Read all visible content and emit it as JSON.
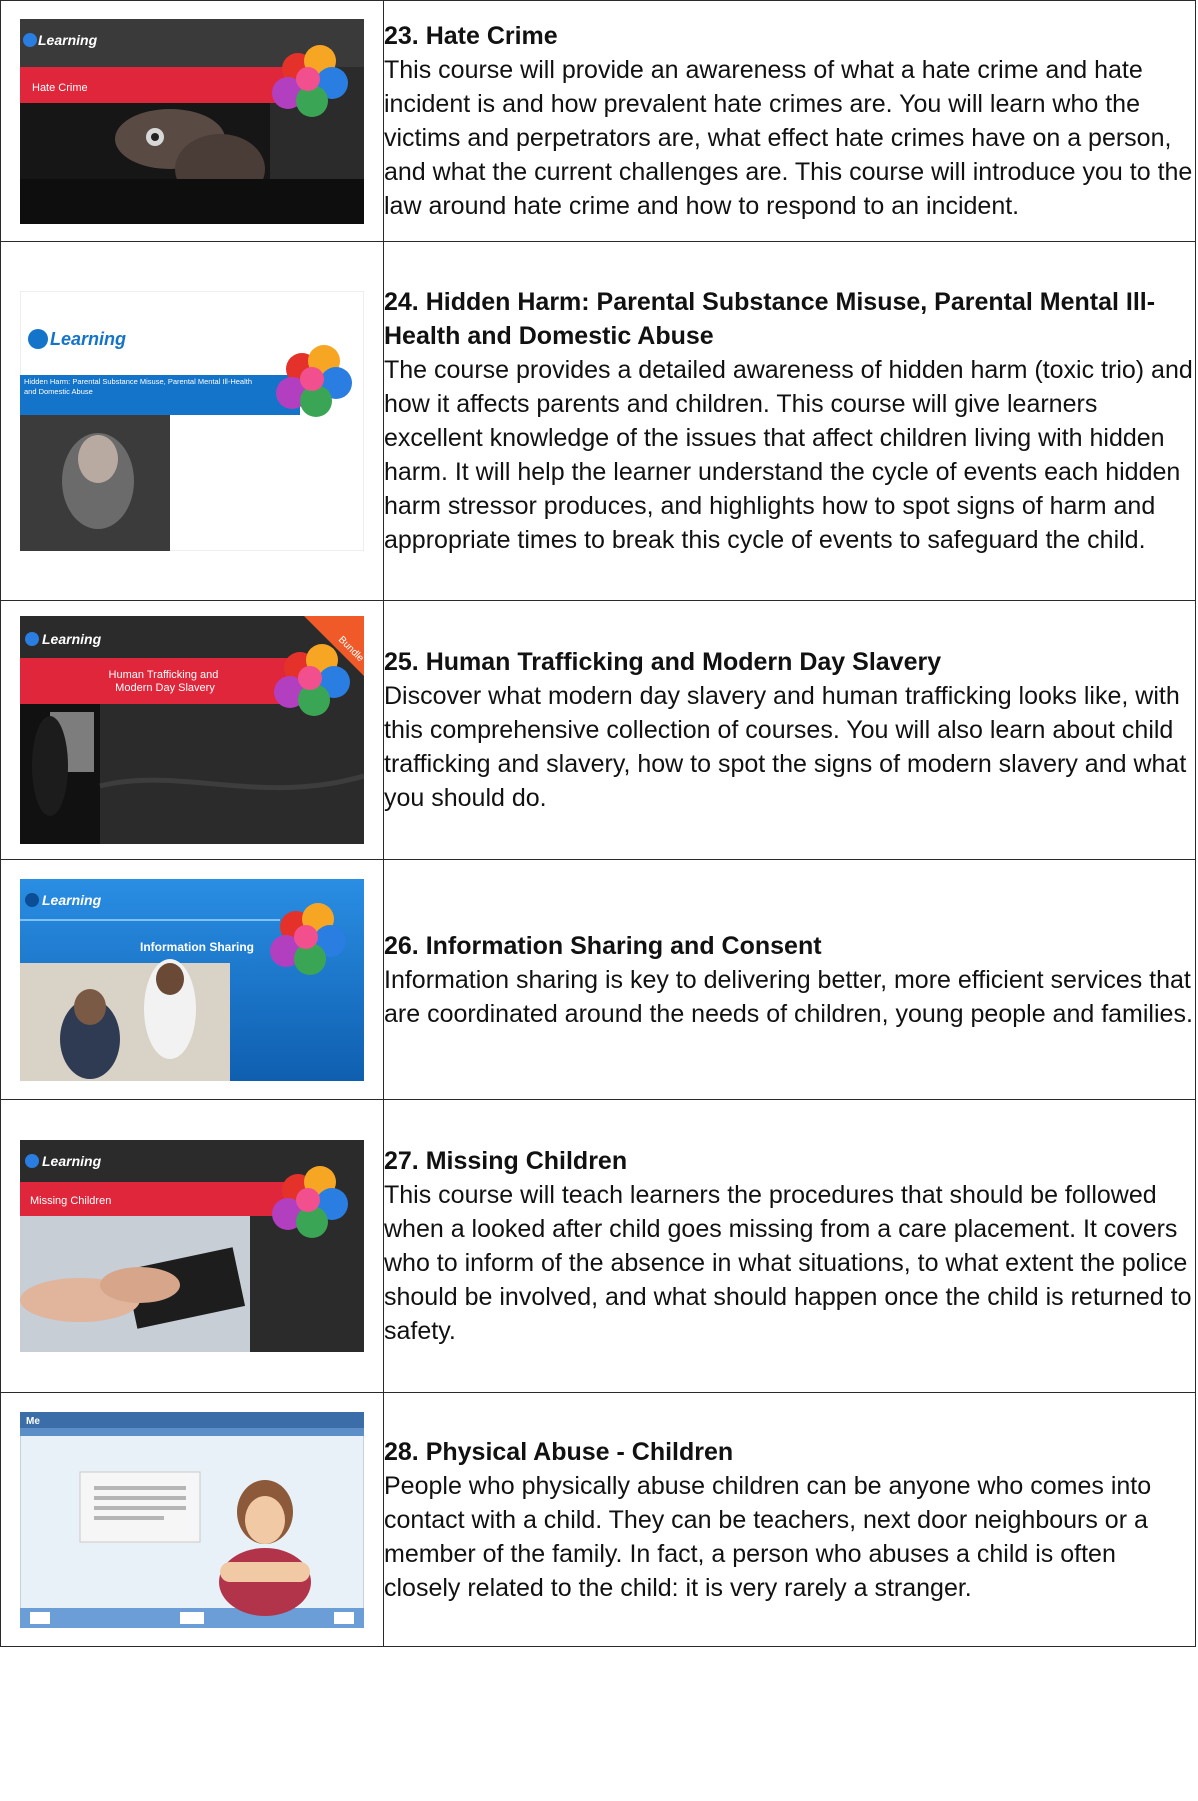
{
  "courses": [
    {
      "title": "23. Hate Crime",
      "description": "This course will provide an awareness of what a hate crime and hate incident is and how prevalent hate crimes are. You will learn who the victims and perpetrators are, what effect hate crimes have on a person, and what the current challenges are. This course will introduce you to the law around hate crime and how to respond to an incident.",
      "thumb": {
        "logo": "Learning",
        "banner": "Hate Crime",
        "theme": "dark"
      }
    },
    {
      "title": "24. Hidden Harm: Parental Substance Misuse, Parental Mental Ill-Health and Domestic Abuse",
      "description": "The course provides a detailed awareness of hidden harm (toxic trio) and how it affects parents and children. This course will give learners excellent knowledge of the issues that affect children living with hidden harm. It will help the learner understand the cycle of events each hidden harm stressor produces, and highlights how to spot signs of harm and appropriate times to break this cycle of events to safeguard the child.",
      "thumb": {
        "logo": "Learning",
        "banner": "Hidden Harm: Parental Substance Misuse, Parental Mental Ill-Health and Domestic Abuse",
        "theme": "white"
      }
    },
    {
      "title": "25. Human Trafficking and Modern Day Slavery",
      "description": "Discover what modern day slavery and human trafficking looks like, with this comprehensive collection of courses. You will also learn about child trafficking and slavery, how to spot the signs of modern slavery and what you should do.",
      "thumb": {
        "logo": "Learning",
        "banner": "Human Trafficking and Modern Day Slavery",
        "ribbon": "Bundle",
        "theme": "dark"
      }
    },
    {
      "title": "26. Information Sharing and Consent",
      "description": "Information sharing is key to delivering better, more efficient services that are coordinated around the needs of children, young people and families.",
      "thumb": {
        "logo": "Learning",
        "banner": "Information Sharing",
        "theme": "blue"
      }
    },
    {
      "title": "27. Missing Children",
      "description": "This course will teach learners the procedures that should be followed when a looked after child goes missing from a care placement. It covers who to inform of the absence in what situations, to what extent the police should be involved, and what should happen once the child is returned to safety.",
      "thumb": {
        "logo": "Learning",
        "banner": "Missing Children",
        "theme": "dark"
      }
    },
    {
      "title": "28. Physical Abuse - Children",
      "description": "People who physically abuse children can be anyone who comes into contact with a child. They can be teachers, next door neighbours or a member of the family. In fact, a person who abuses a child is often closely related to the child: it is very rarely a stranger.",
      "thumb": {
        "logo": "Me",
        "theme": "screen"
      }
    }
  ],
  "colors": {
    "border": "#2a2a2a",
    "banner_red": "#e0263a",
    "dark_bg": "#2b2b2b",
    "blue_bg": "#1474c9",
    "balloon_colors": [
      "#e4322b",
      "#f6a623",
      "#3aa655",
      "#2a7de1",
      "#b23fc0",
      "#f24f8f"
    ]
  }
}
